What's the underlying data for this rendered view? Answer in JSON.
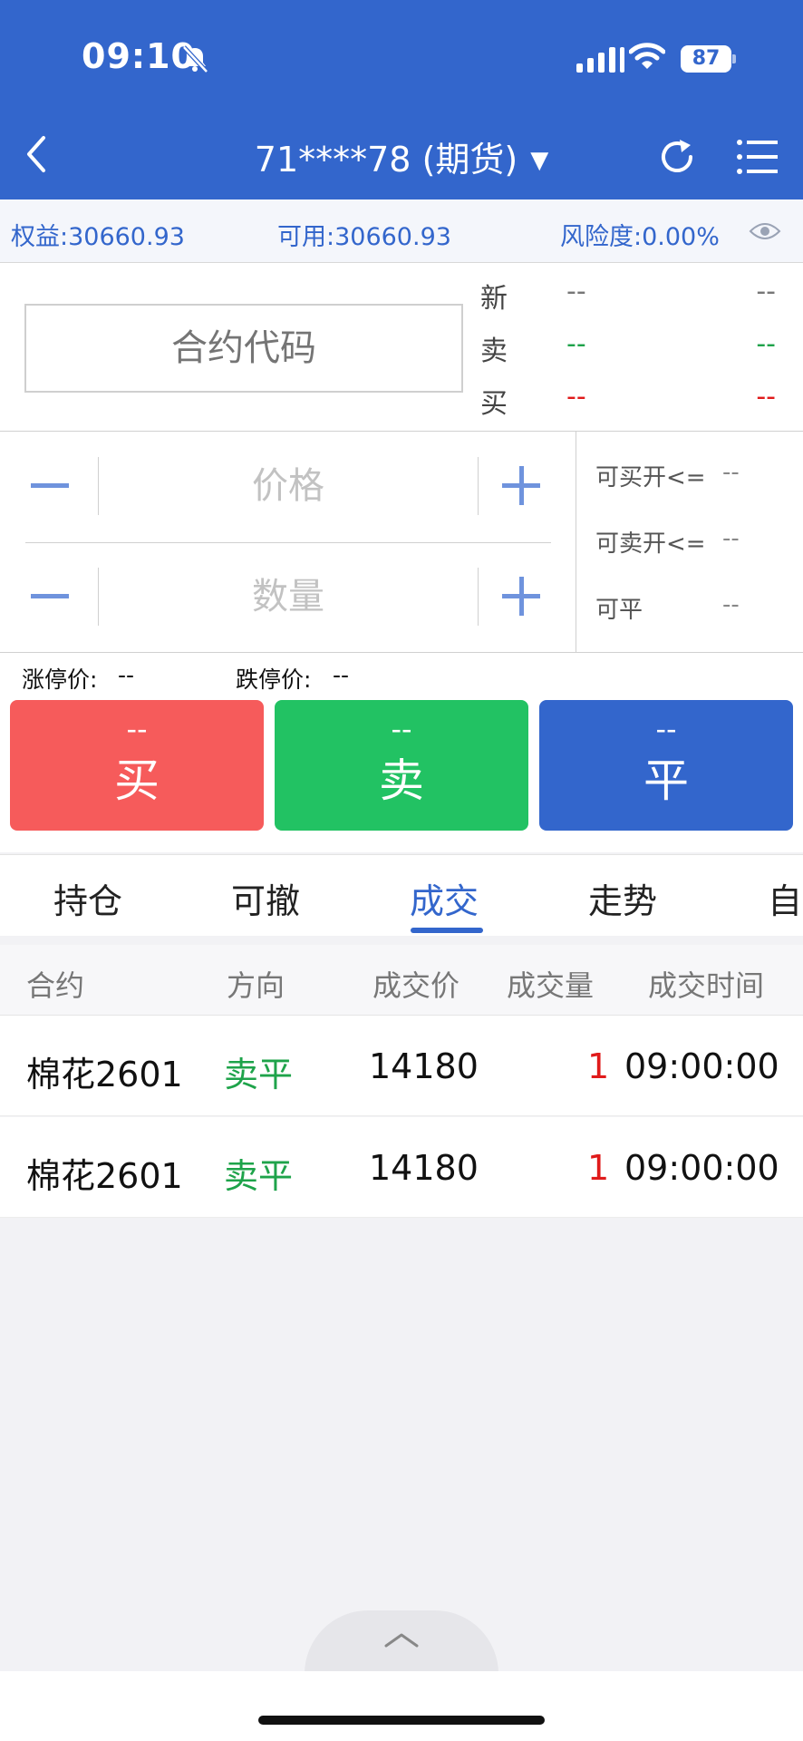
{
  "status_bar": {
    "time": "09:10",
    "battery": "87"
  },
  "nav": {
    "title": "71****78 (期货)",
    "caret": "▼"
  },
  "account": {
    "equity": "权益:30660.93",
    "available": "可用:30660.93",
    "risk": "风险度:0.00%"
  },
  "contract": {
    "code_placeholder": "合约代码",
    "quotes": [
      {
        "label": "新",
        "a": "--",
        "b": "--",
        "color": "#777777"
      },
      {
        "label": "卖",
        "a": "--",
        "b": "--",
        "color": "#1ea34a"
      },
      {
        "label": "买",
        "a": "--",
        "b": "--",
        "color": "#e01b1b"
      }
    ]
  },
  "order": {
    "price_placeholder": "价格",
    "qty_placeholder": "数量",
    "limits": [
      {
        "label": "可买开<=",
        "value": "--"
      },
      {
        "label": "可卖开<=",
        "value": "--"
      },
      {
        "label": "可平",
        "value": "--"
      }
    ]
  },
  "bands": {
    "upper_label": "涨停价:",
    "upper_value": "--",
    "lower_label": "跌停价:",
    "lower_value": "--"
  },
  "actions": {
    "buy": {
      "price": "--",
      "label": "买"
    },
    "sell": {
      "price": "--",
      "label": "卖"
    },
    "close": {
      "price": "--",
      "label": "平"
    }
  },
  "tabs": [
    {
      "label": "持仓",
      "active": false
    },
    {
      "label": "可撤",
      "active": false
    },
    {
      "label": "成交",
      "active": true
    },
    {
      "label": "走势",
      "active": false
    },
    {
      "label": "自",
      "active": false
    }
  ],
  "trades": {
    "columns": [
      "合约",
      "方向",
      "成交价",
      "成交量",
      "成交时间"
    ],
    "rows": [
      {
        "contract": "棉花2601",
        "direction": "卖平",
        "price": "14180",
        "volume": "1",
        "time": "09:00:00"
      },
      {
        "contract": "棉花2601",
        "direction": "卖平",
        "price": "14180",
        "volume": "1",
        "time": "09:00:00"
      }
    ]
  },
  "colors": {
    "brand": "#3366cc",
    "buy": "#f65b5b",
    "sell": "#22c263",
    "close": "#3366cc",
    "up": "#e01b1b",
    "down": "#1ea34a"
  },
  "icons": [
    "bell-off-icon",
    "signal-icon",
    "wifi-icon",
    "battery-icon",
    "back-icon",
    "refresh-icon",
    "menu-icon",
    "eye-icon",
    "minus-icon",
    "plus-icon",
    "chevron-up-icon"
  ]
}
